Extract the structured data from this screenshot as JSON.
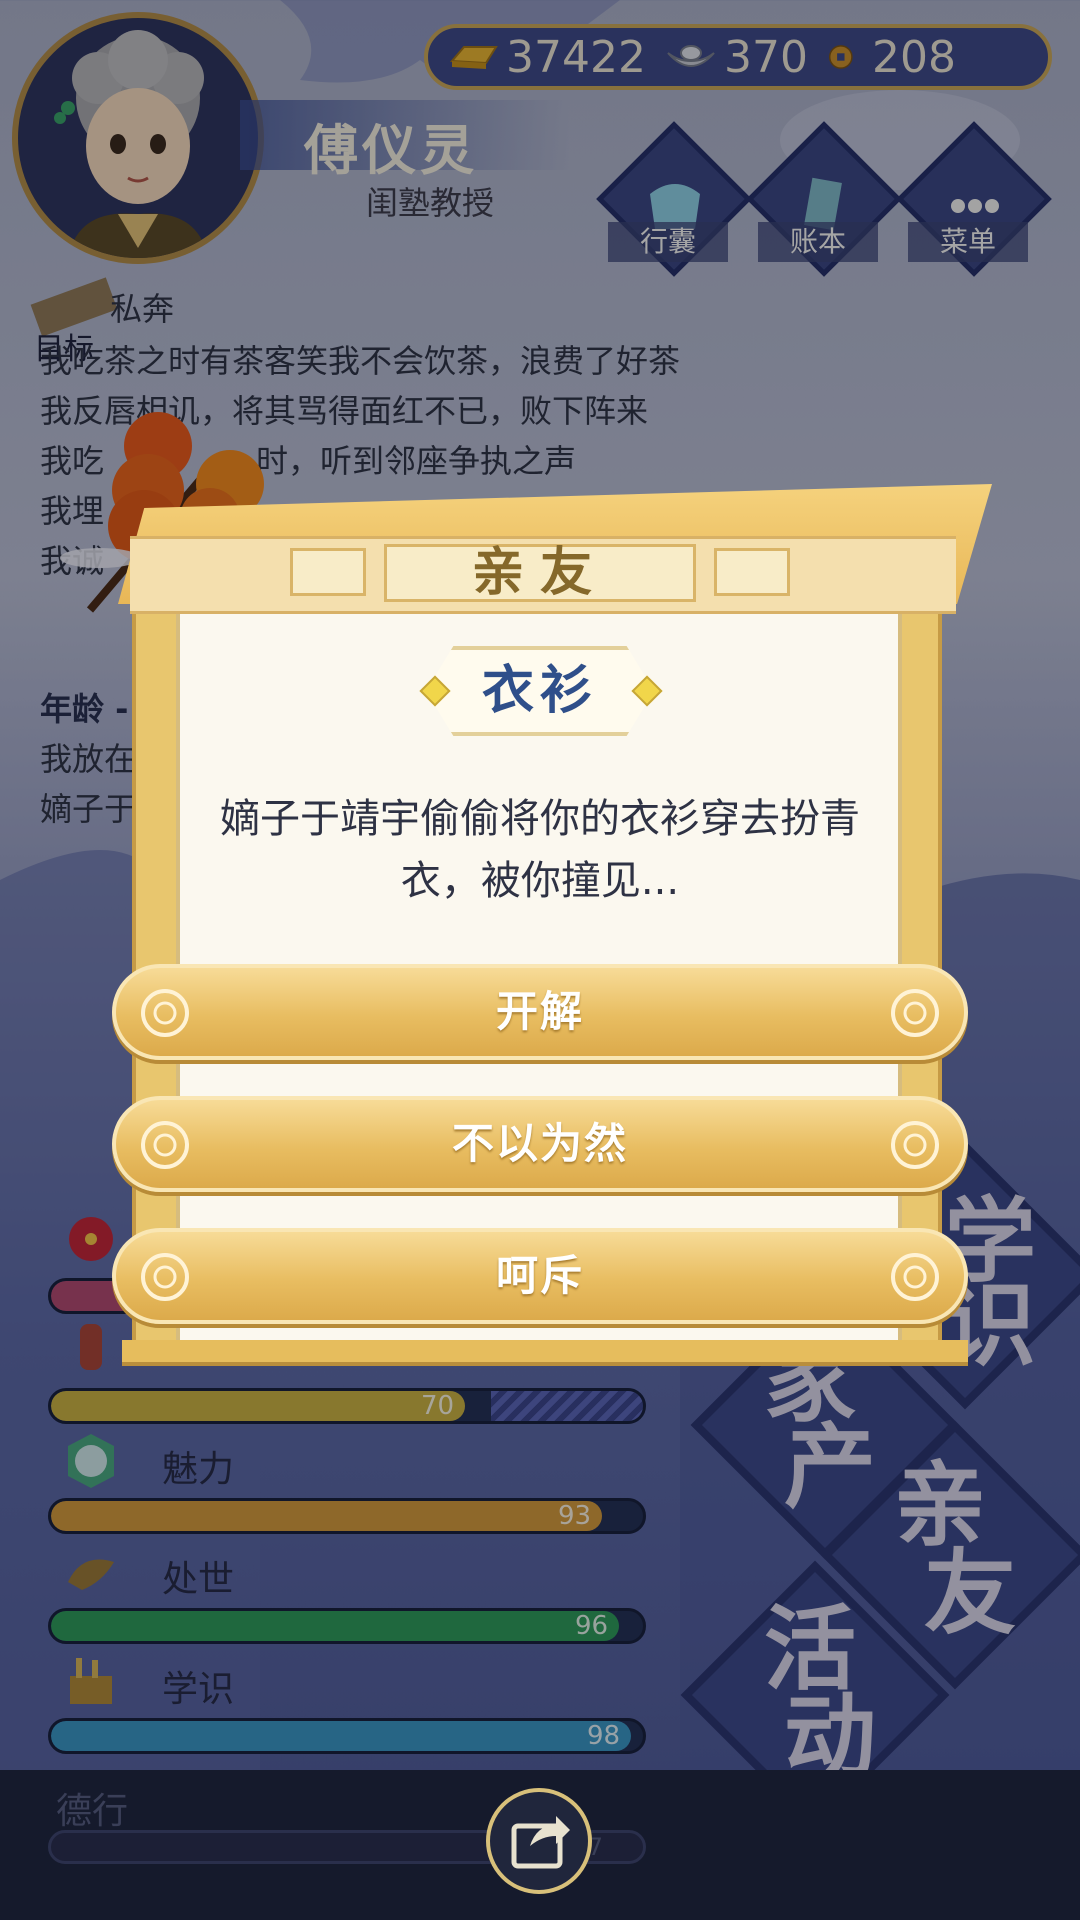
{
  "header": {
    "currencies": [
      {
        "icon": "gold-ingot-icon",
        "value": "37422"
      },
      {
        "icon": "silver-yuanbao-icon",
        "value": "370"
      },
      {
        "icon": "copper-coin-icon",
        "value": "208"
      }
    ],
    "player_name": "傅仪灵",
    "player_title": "闺塾教授",
    "menu": [
      {
        "label": "行囊",
        "icon": "bag-icon"
      },
      {
        "label": "账本",
        "icon": "ledger-icon"
      },
      {
        "label": "菜单",
        "icon": "more-icon"
      }
    ]
  },
  "goal": {
    "label": "目标",
    "text": "私奔"
  },
  "log": [
    "我吃茶之时有茶客笑我不会饮茶，浪费了好茶",
    "我反唇相讥，将其骂得面红不已，败下阵来",
    "我吃",
    "时，听到邻座争执之声",
    "我埋",
    "我诚",
    "年龄 -",
    "我放在",
    "嫡子于"
  ],
  "stats": [
    {
      "name": "",
      "value": 70,
      "max": 100,
      "color": "#c9b244",
      "icon": "vase-icon"
    },
    {
      "name": "魅力",
      "value": 93,
      "max": 100,
      "color": "#d29a3e",
      "icon": "mirror-icon"
    },
    {
      "name": "处世",
      "value": 96,
      "max": 100,
      "color": "#2f9a5c",
      "icon": "fan-icon"
    },
    {
      "name": "学识",
      "value": 98,
      "max": 100,
      "color": "#3a95c4",
      "icon": "books-icon"
    },
    {
      "name": "德行",
      "value": 7,
      "max": 100,
      "color": "#6a4aa0",
      "icon": "jade-icon"
    }
  ],
  "right_nav": [
    {
      "label_a": "学",
      "label_b": "识"
    },
    {
      "label_a": "家",
      "label_b": "产"
    },
    {
      "label_a": "亲",
      "label_b": "友"
    },
    {
      "label_a": "活",
      "label_b": "动"
    }
  ],
  "dialog": {
    "category": "亲友",
    "tag": "衣衫",
    "text": "嫡子于靖宇偷偷将你的衣衫穿去扮青衣，被你撞见...",
    "options": [
      "开解",
      "不以为然",
      "呵斥"
    ]
  },
  "bottom": {
    "share_icon": "share-icon"
  }
}
